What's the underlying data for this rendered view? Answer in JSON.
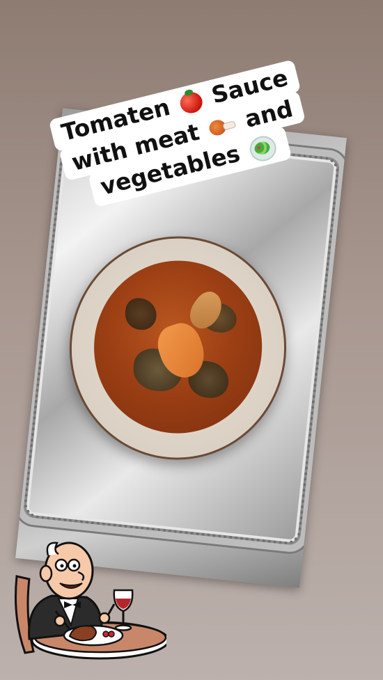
{
  "caption": {
    "line1": "Tomaten",
    "line1_after": "Sauce",
    "line2": "with meat",
    "line2_after": "and",
    "line3": "vegetables",
    "icons": [
      "tomato-icon",
      "meat-on-bone-icon",
      "green-salad-icon"
    ]
  },
  "photo": {
    "subject": "bowl of tomato stew on silver tray"
  },
  "sticker": {
    "icon": "diner-chef-icon"
  },
  "colors": {
    "background_top": "#8e7c72",
    "background_bottom": "#bcb1ad",
    "caption_bg": "#ffffff",
    "caption_text": "#111111"
  }
}
